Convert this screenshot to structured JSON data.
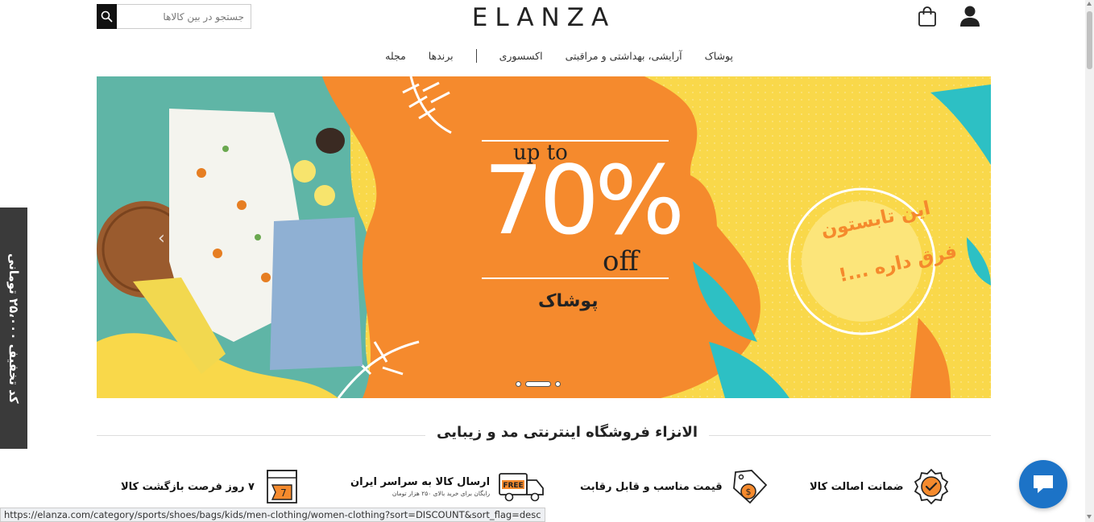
{
  "header": {
    "logo": "ELANZA",
    "search_placeholder": "جستجو در بین کالاها"
  },
  "nav": {
    "items": [
      "پوشاک",
      "آرایشی، بهداشتی و مراقبتی",
      "اکسسوری",
      "برندها",
      "مجله"
    ]
  },
  "banner": {
    "up_to": "up to",
    "percent": "70%",
    "off": "off",
    "category": "پوشاک",
    "slogan_line1": "این تابستون",
    "slogan_line2": "فرق داره ...!",
    "dots": 3,
    "active_dot": 2
  },
  "coupon": {
    "text": "کد تخفیف ۲۵،۰۰۰ تومانی"
  },
  "section": {
    "title": "الانزاء فروشگاه اینترنتی مد و زیبایی"
  },
  "features": [
    {
      "title": "ضمانت اصالت کالا",
      "icon": "badge-check-icon"
    },
    {
      "title": "قیمت مناسب و قابل رقابت",
      "icon": "price-tag-icon"
    },
    {
      "title": "ارسال کالا به سراسر ایران",
      "subtitle": "رایگان برای خرید بالای ۲۵۰ هزار تومان",
      "icon": "free-delivery-truck-icon"
    },
    {
      "title": "۷ روز فرصت بازگشت کالا",
      "icon": "calendar-return-icon"
    }
  ],
  "statusbar": {
    "url": "https://elanza.com/category/sports/shoes/bags/kids/men-clothing/women-clothing?sort=DISCOUNT&sort_flag=desc"
  },
  "colors": {
    "banner_yellow": "#f9d84a",
    "banner_orange": "#f58a2d",
    "banner_teal": "#5fb5a6",
    "chat_blue": "#1c73c7"
  }
}
